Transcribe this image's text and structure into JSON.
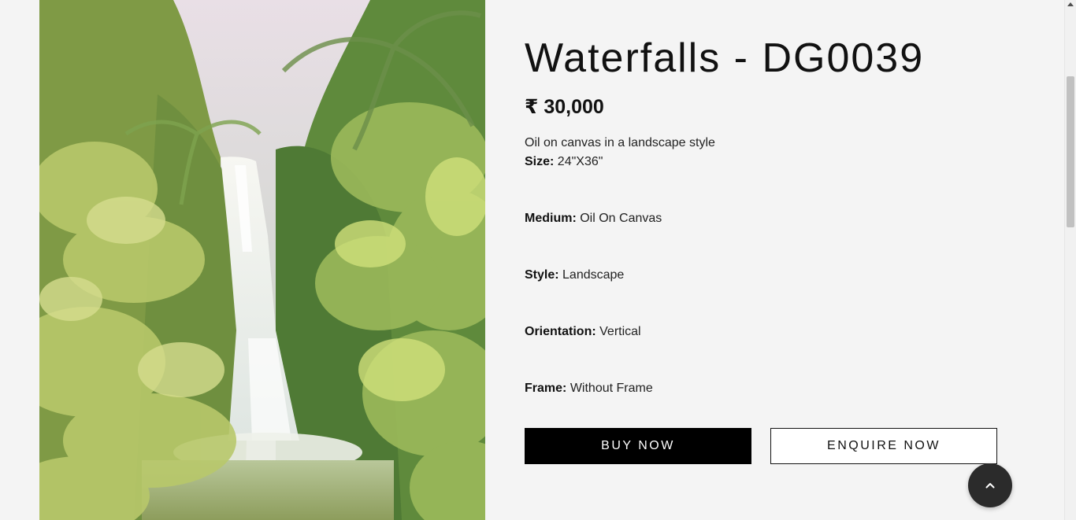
{
  "product": {
    "title": "Waterfalls - DG0039",
    "price": "₹ 30,000",
    "description": "Oil on canvas in a landscape style",
    "specs": {
      "size": {
        "label": "Size:",
        "value": "24\"X36\""
      },
      "medium": {
        "label": "Medium:",
        "value": "Oil On Canvas"
      },
      "style": {
        "label": "Style:",
        "value": "Landscape"
      },
      "orientation": {
        "label": "Orientation:",
        "value": "Vertical"
      },
      "frame": {
        "label": "Frame:",
        "value": "Without Frame"
      }
    },
    "image_alt_icon": "waterfall-painting"
  },
  "actions": {
    "buy_label": "BUY NOW",
    "enquire_label": "ENQUIRE NOW"
  },
  "icons": {
    "back_to_top": "chevron-up-icon"
  },
  "colors": {
    "background": "#f4f4f4",
    "buy_button": "#000000",
    "back_to_top": "#2b2b2b"
  }
}
